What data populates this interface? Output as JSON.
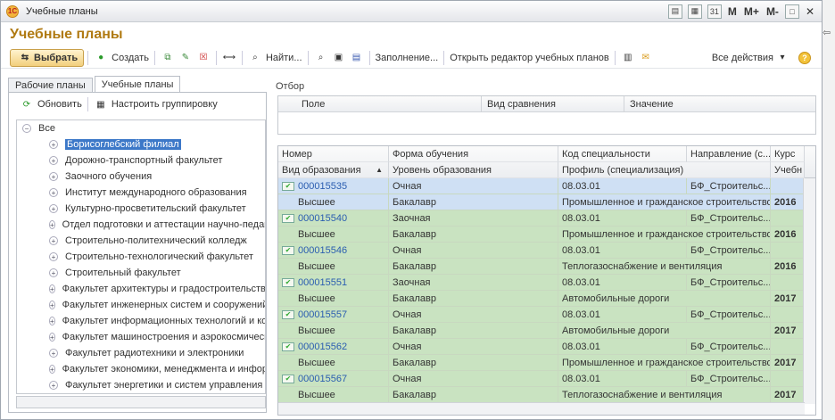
{
  "window": {
    "title": "Учебные планы",
    "memory_buttons": [
      "M",
      "M+",
      "M-"
    ]
  },
  "page_title": "Учебные планы",
  "toolbar": {
    "select": "Выбрать",
    "create": "Создать",
    "find": "Найти...",
    "fill": "Заполнение...",
    "open_editor": "Открыть редактор учебных планов",
    "all_actions": "Все действия"
  },
  "tabs": [
    "Рабочие планы",
    "Учебные планы"
  ],
  "left": {
    "refresh": "Обновить",
    "grouping": "Настроить группировку",
    "root": "Все",
    "items": [
      "Борисоглебский филиал",
      "Дорожно-транспортный факультет",
      "Заочного обучения",
      "Институт международного образования",
      "Культурно-просветительский факультет",
      "Отдел подготовки и аттестации научно-педагоги",
      "Строительно-политехнический колледж",
      "Строительно-технологический факультет",
      "Строительный факультет",
      "Факультет архитектуры и градостроительства",
      "Факультет инженерных систем и сооружений",
      "Факультет информационных технологий и комп",
      "Факультет машиностроения и аэрокосмической",
      "Факультет радиотехники и электроники",
      "Факультет экономики, менеджмента и информа",
      "Факультет энергетики и систем управления"
    ]
  },
  "filter": {
    "label": "Отбор",
    "columns": [
      "Поле",
      "Вид сравнения",
      "Значение"
    ]
  },
  "grid": {
    "head1": [
      "Номер",
      "Форма обучения",
      "Код специальности",
      "Направление (с...",
      "Курс"
    ],
    "head2": [
      "Вид образования",
      "Уровень образования",
      "Профиль (специализация)",
      "Учебн"
    ],
    "records": [
      {
        "num": "000015535",
        "form": "Очная",
        "code": "08.03.01",
        "dir": "БФ_Строительс...",
        "type": "Высшее",
        "level": "Бакалавр",
        "profile": "Промышленное и гражданское строительство",
        "year": "2016"
      },
      {
        "num": "000015540",
        "form": "Заочная",
        "code": "08.03.01",
        "dir": "БФ_Строительс...",
        "type": "Высшее",
        "level": "Бакалавр",
        "profile": "Промышленное и гражданское строительство",
        "year": "2016"
      },
      {
        "num": "000015546",
        "form": "Очная",
        "code": "08.03.01",
        "dir": "БФ_Строительс...",
        "type": "Высшее",
        "level": "Бакалавр",
        "profile": "Теплогазоснабжение и вентиляция",
        "year": "2016"
      },
      {
        "num": "000015551",
        "form": "Заочная",
        "code": "08.03.01",
        "dir": "БФ_Строительс...",
        "type": "Высшее",
        "level": "Бакалавр",
        "profile": "Автомобильные дороги",
        "year": "2017"
      },
      {
        "num": "000015557",
        "form": "Очная",
        "code": "08.03.01",
        "dir": "БФ_Строительс...",
        "type": "Высшее",
        "level": "Бакалавр",
        "profile": "Автомобильные дороги",
        "year": "2017"
      },
      {
        "num": "000015562",
        "form": "Очная",
        "code": "08.03.01",
        "dir": "БФ_Строительс...",
        "type": "Высшее",
        "level": "Бакалавр",
        "profile": "Промышленное и гражданское строительство",
        "year": "2017"
      },
      {
        "num": "000015567",
        "form": "Очная",
        "code": "08.03.01",
        "dir": "БФ_Строительс...",
        "type": "Высшее",
        "level": "Бакалавр",
        "profile": "Теплогазоснабжение и вентиляция",
        "year": "2017"
      }
    ]
  }
}
